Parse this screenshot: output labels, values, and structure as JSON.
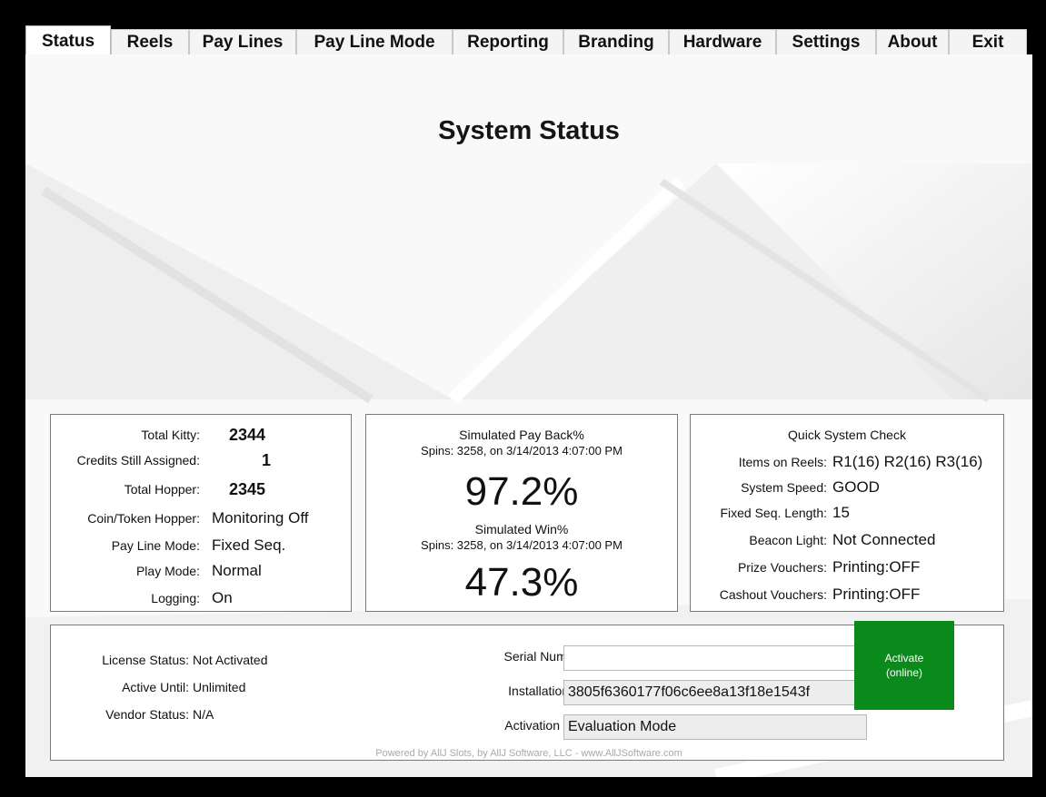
{
  "tabs": [
    {
      "label": "Status",
      "active": true
    },
    {
      "label": "Reels"
    },
    {
      "label": "Pay Lines"
    },
    {
      "label": "Pay Line Mode"
    },
    {
      "label": "Reporting"
    },
    {
      "label": "Branding"
    },
    {
      "label": "Hardware"
    },
    {
      "label": "Settings"
    },
    {
      "label": "About"
    },
    {
      "label": "Exit"
    }
  ],
  "page_title": "System Status",
  "stats": {
    "total_kitty_label": "Total Kitty:",
    "total_kitty": "2344",
    "credits_label": "Credits Still Assigned:",
    "credits": "1",
    "total_hopper_label": "Total Hopper:",
    "total_hopper": "2345",
    "coin_hopper_label": "Coin/Token Hopper:",
    "coin_hopper": "Monitoring Off",
    "pay_line_mode_label": "Pay Line Mode:",
    "pay_line_mode": "Fixed Seq.",
    "play_mode_label": "Play Mode:",
    "play_mode": "Normal",
    "logging_label": "Logging:",
    "logging": "On"
  },
  "simulation": {
    "payback_title": "Simulated Pay Back%",
    "payback_spins": "Spins: 3258, on 3/14/2013 4:07:00 PM",
    "payback_value": "97.2%",
    "win_title": "Simulated Win%",
    "win_spins": "Spins: 3258, on 3/14/2013 4:07:00 PM",
    "win_value": "47.3%"
  },
  "system_check": {
    "title": "Quick System Check",
    "items_label": "Items on Reels:",
    "items": "R1(16) R2(16) R3(16)",
    "speed_label": "System Speed:",
    "speed": "GOOD",
    "fixed_len_label": "Fixed Seq. Length:",
    "fixed_len": "15",
    "beacon_label": "Beacon Light:",
    "beacon": "Not Connected",
    "prize_label": "Prize Vouchers:",
    "prize": "Printing:OFF",
    "cashout_label": "Cashout Vouchers:",
    "cashout": "Printing:OFF"
  },
  "license": {
    "status_label": "License Status:",
    "status": "Not Activated",
    "until_label": "Active Until:",
    "until": "Unlimited",
    "vendor_label": "Vendor Status:",
    "vendor": "N/A",
    "serial_label": "Serial Number",
    "serial": "",
    "install_label": "Installation ID",
    "install_id": "3805f6360177f06c6ee8a13f18e1543f",
    "key_label": "Activation Key",
    "key": "Evaluation Mode",
    "activate_line1": "Activate",
    "activate_line2": "(online)",
    "activate_color": "#0a8a1a"
  },
  "footer": "Powered by AllJ Slots, by AllJ Software, LLC - www.AllJSoftware.com"
}
